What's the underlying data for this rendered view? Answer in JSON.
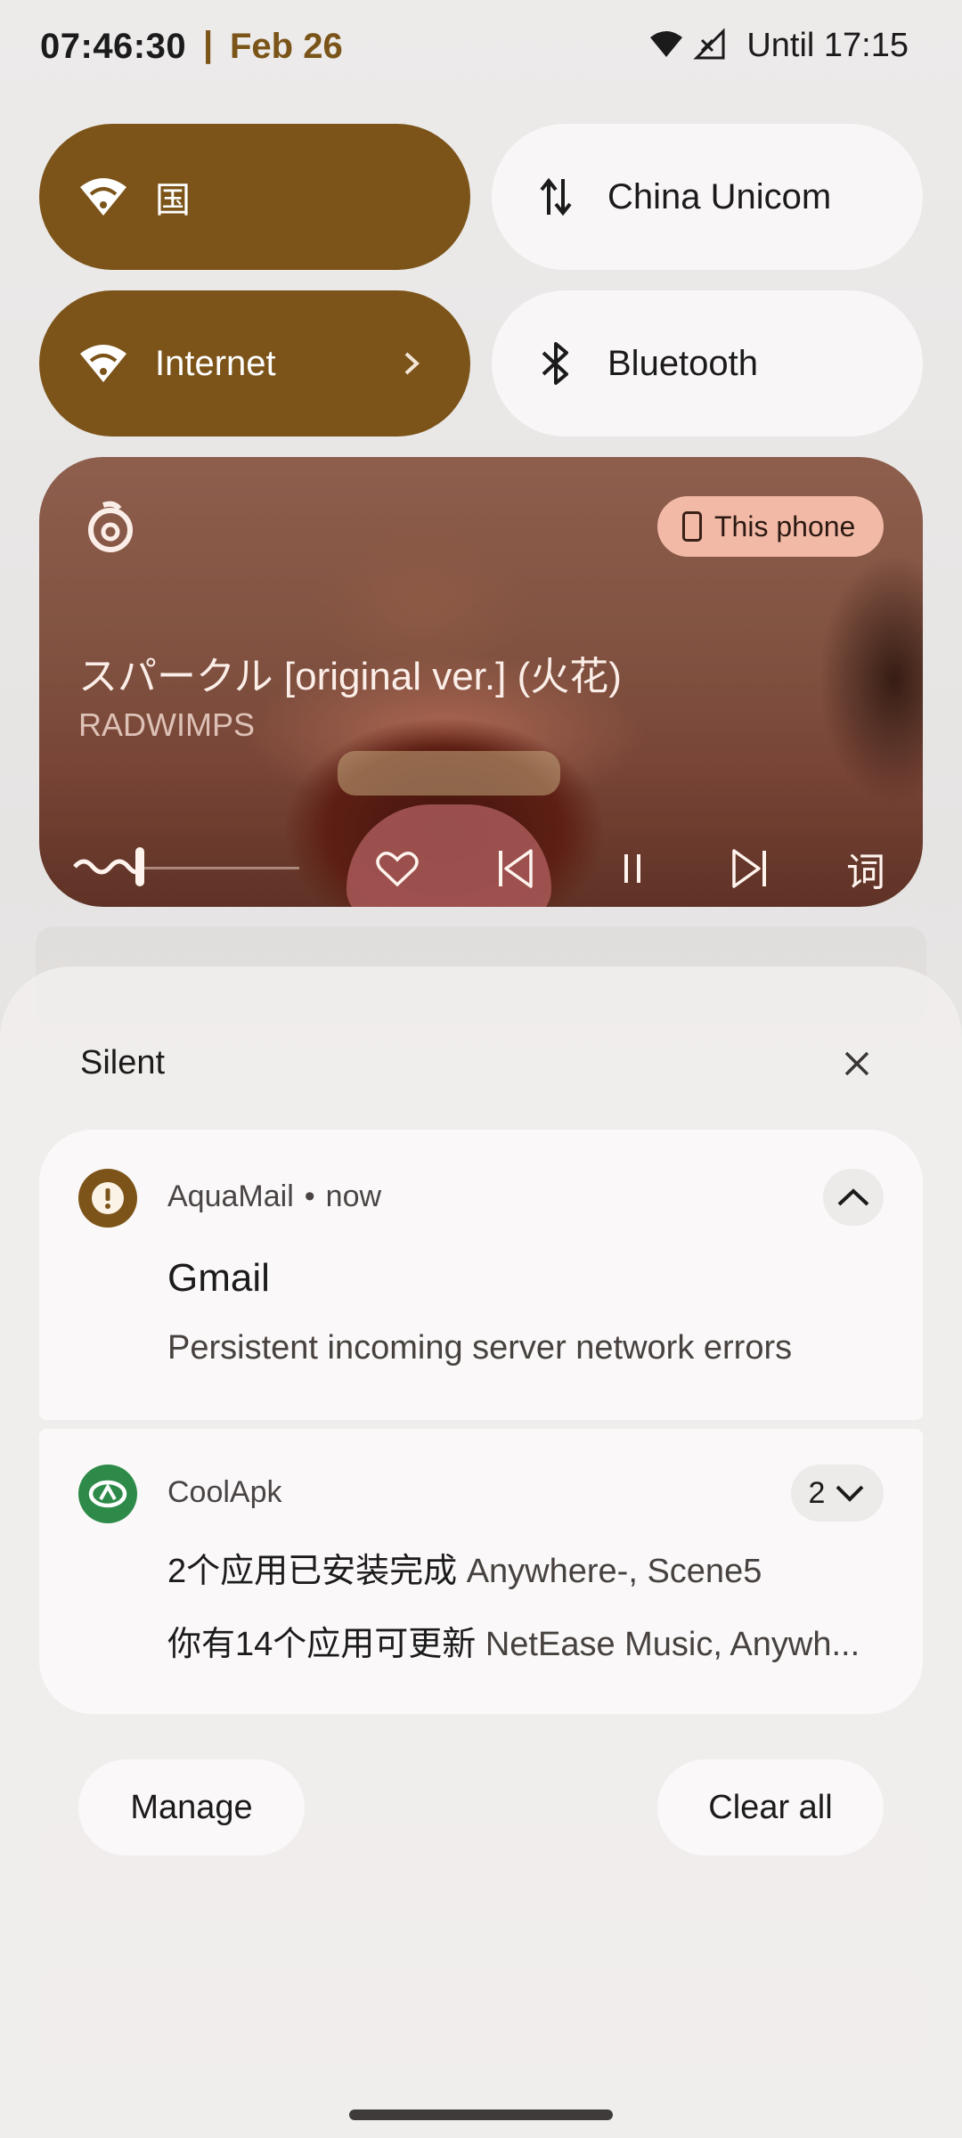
{
  "status_bar": {
    "time": "07:46:30",
    "separator": "|",
    "date": "Feb 26",
    "until": "Until 17:15"
  },
  "quick_settings": {
    "wifi_tile_label": "国",
    "mobile_data_label": "China Unicom",
    "internet_label": "Internet",
    "bluetooth_label": "Bluetooth"
  },
  "media": {
    "app_icon": "netease-music-icon",
    "output_chip": "This phone",
    "title": "スパークル [original ver.] (火花)",
    "artist": "RADWIMPS",
    "progress": 0.1,
    "lyrics_label": "词",
    "controls": [
      "like-icon",
      "previous-icon",
      "pause-icon",
      "next-icon"
    ]
  },
  "shade": {
    "section_title": "Silent",
    "notifications": [
      {
        "app": "AquaMail",
        "time": "now",
        "title": "Gmail",
        "body": "Persistent incoming server network errors"
      },
      {
        "app": "CoolApk",
        "count": "2",
        "line1_strong": "2个应用已安装完成",
        "line1_rest": "Anywhere-, Scene5",
        "line2_strong": "你有14个应用可更新",
        "line2_rest": "NetEase Music, Anywh..."
      }
    ],
    "manage_label": "Manage",
    "clear_all_label": "Clear all"
  },
  "colors": {
    "accent": "#7c5419",
    "tile_off": "#f8f6f6",
    "coolapk_green": "#2e8a49"
  }
}
